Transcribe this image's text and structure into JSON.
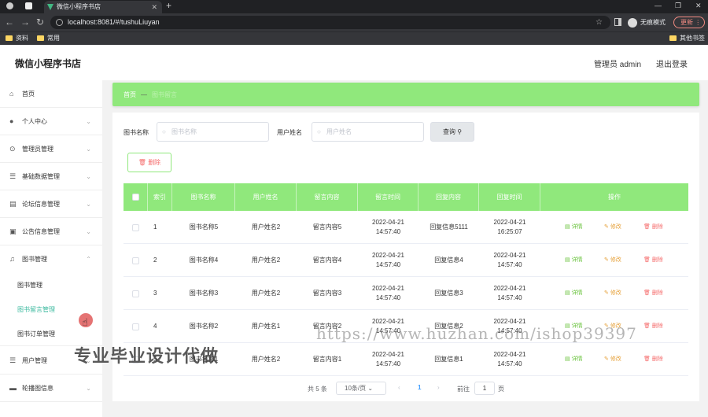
{
  "browser": {
    "tab_title": "微信小程序书店",
    "url": "localhost:8081/#/tushuLiuyan",
    "incognito_label": "无痕模式",
    "update_label": "更新",
    "bookmarks": [
      "资料",
      "常用"
    ],
    "other_bookmarks": "其他书签"
  },
  "header": {
    "brand": "微信小程序书店",
    "admin": "管理员 admin",
    "logout": "退出登录"
  },
  "sidebar": {
    "items": [
      {
        "label": "首页",
        "icon": "home-icon"
      },
      {
        "label": "个人中心",
        "icon": "user-icon"
      },
      {
        "label": "管理员管理",
        "icon": "admin-icon"
      },
      {
        "label": "基础数据管理",
        "icon": "sliders-icon"
      },
      {
        "label": "论坛信息管理",
        "icon": "forum-icon"
      },
      {
        "label": "公告信息管理",
        "icon": "notice-icon"
      },
      {
        "label": "图书管理",
        "icon": "bell-icon"
      }
    ],
    "sub_items": [
      "图书管理",
      "图书留言管理",
      "图书订单管理"
    ],
    "items_after": [
      {
        "label": "用户管理",
        "icon": "users-icon"
      },
      {
        "label": "轮播图信息",
        "icon": "carousel-icon"
      }
    ]
  },
  "breadcrumb": {
    "home": "首页",
    "separator": "—",
    "current": "图书留言"
  },
  "search": {
    "book_label": "图书名称",
    "book_placeholder": "图书名称",
    "user_label": "用户姓名",
    "user_placeholder": "用户姓名",
    "query_label": "查询"
  },
  "toolbar": {
    "delete_label": "删除"
  },
  "table": {
    "columns": [
      "索引",
      "图书名称",
      "用户姓名",
      "留言内容",
      "留言时间",
      "回复内容",
      "回复时间",
      "操作"
    ],
    "rows": [
      {
        "index": "1",
        "book": "图书名称5",
        "user": "用户姓名2",
        "content": "留言内容5",
        "time": "2022-04-21 14:57:40",
        "reply": "回复信息5111",
        "reply_time": "2022-04-21 16:25:07"
      },
      {
        "index": "2",
        "book": "图书名称4",
        "user": "用户姓名2",
        "content": "留言内容4",
        "time": "2022-04-21 14:57:40",
        "reply": "回复信息4",
        "reply_time": "2022-04-21 14:57:40"
      },
      {
        "index": "3",
        "book": "图书名称3",
        "user": "用户姓名2",
        "content": "留言内容3",
        "time": "2022-04-21 14:57:40",
        "reply": "回复信息3",
        "reply_time": "2022-04-21 14:57:40"
      },
      {
        "index": "4",
        "book": "图书名称2",
        "user": "用户姓名1",
        "content": "留言内容2",
        "time": "2022-04-21 14:57:40",
        "reply": "回复信息2",
        "reply_time": "2022-04-21 14:57:40"
      },
      {
        "index": "5",
        "book": "图书名称1",
        "user": "用户姓名2",
        "content": "留言内容1",
        "time": "2022-04-21 14:57:40",
        "reply": "回复信息1",
        "reply_time": "2022-04-21 14:57:40"
      }
    ],
    "actions": {
      "detail": "详情",
      "edit": "修改",
      "delete": "删除"
    }
  },
  "pagination": {
    "total": "共 5 条",
    "page_size": "10条/页",
    "current_page": "1",
    "goto_label": "前往",
    "goto_value": "1",
    "page_suffix": "页"
  },
  "watermark": {
    "text": "专业毕业设计代做",
    "url": "https://www.huzhan.com/ishop39397"
  },
  "colors": {
    "accent": "#90e87c",
    "active_sub": "#3cba9f",
    "danger": "#f56c6c",
    "warning": "#e6a23c",
    "success": "#67c23a"
  }
}
